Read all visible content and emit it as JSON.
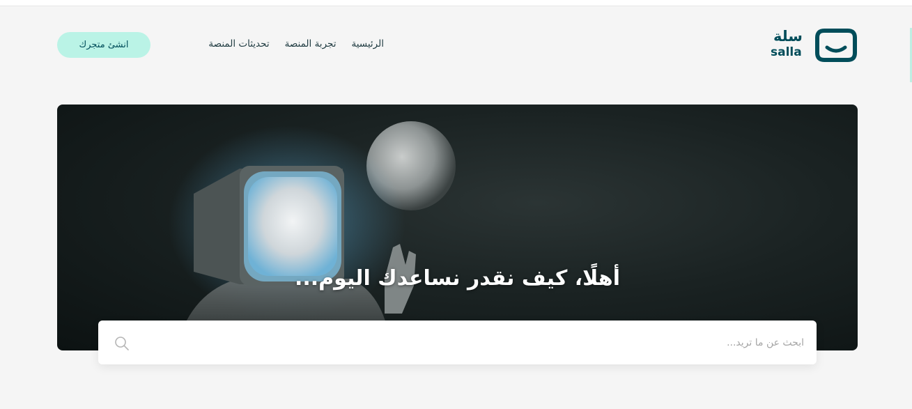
{
  "brand": {
    "name_ar": "سلة",
    "name_en": "salla",
    "color": "#004d5a",
    "accent": "#baf3e6"
  },
  "nav": {
    "items": [
      {
        "label": "الرئيسية"
      },
      {
        "label": "تجربة المنصة"
      },
      {
        "label": "تحديثات المنصة"
      }
    ],
    "cta_label": "انشئ متجرك"
  },
  "hero": {
    "title": "أهلًا، كيف نقدر نساعدك اليوم..."
  },
  "search": {
    "placeholder": "ابحث عن ما تريد...",
    "icon": "search-icon"
  }
}
